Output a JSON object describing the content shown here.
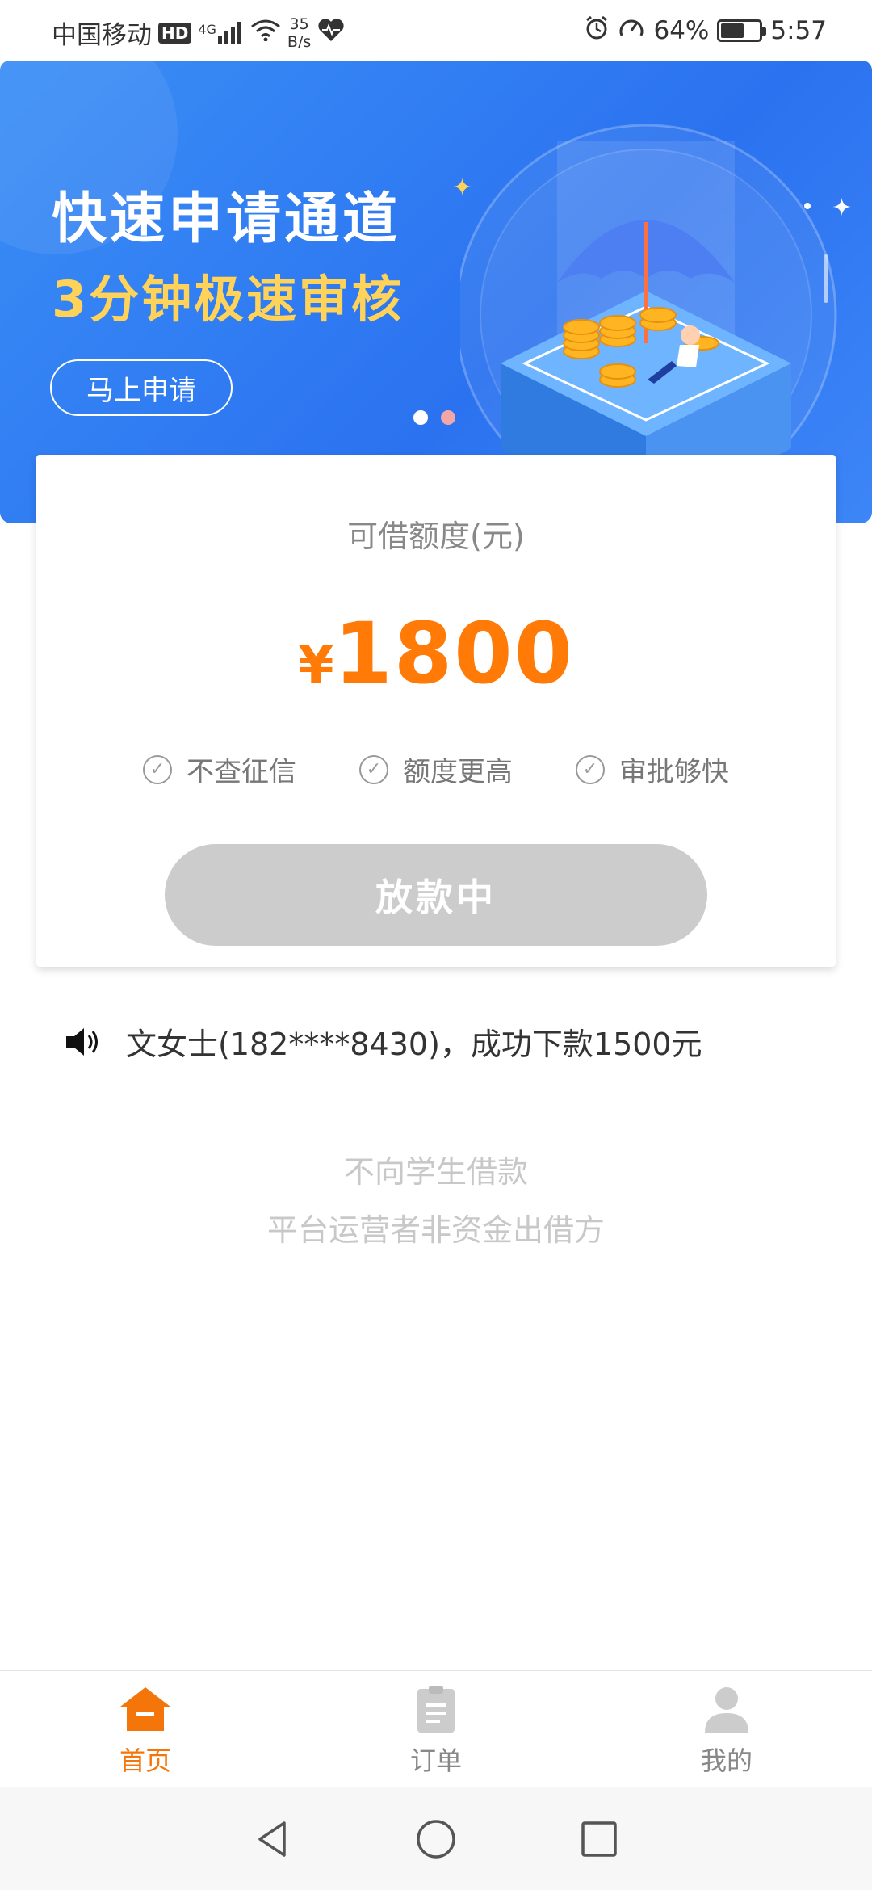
{
  "status_bar": {
    "carrier": "中国移动",
    "hd": "HD",
    "network": "4G",
    "speed_value": "35",
    "speed_unit": "B/s",
    "battery": "64%",
    "battery_level": 0.64,
    "time": "5:57"
  },
  "banner": {
    "title": "快速申请通道",
    "subtitle": "3分钟极速审核",
    "apply_label": "马上申请",
    "active_dot_color": "#ffffff",
    "inactive_dot_color": "#f2a7a7"
  },
  "card": {
    "label": "可借额度(元)",
    "currency": "¥",
    "amount": "1800",
    "features": [
      "不查征信",
      "额度更高",
      "审批够快"
    ],
    "button_label": "放款中",
    "accent_color": "#ff7a06"
  },
  "notice": {
    "text": "文女士(182****8430)，成功下款1500元"
  },
  "disclaimer": {
    "line1": "不向学生借款",
    "line2": "平台运营者非资金出借方"
  },
  "bottom_nav": {
    "items": [
      {
        "label": "首页",
        "icon": "home-icon",
        "active": true
      },
      {
        "label": "订单",
        "icon": "clipboard-icon",
        "active": false
      },
      {
        "label": "我的",
        "icon": "user-icon",
        "active": false
      }
    ],
    "active_color": "#f4760a"
  }
}
